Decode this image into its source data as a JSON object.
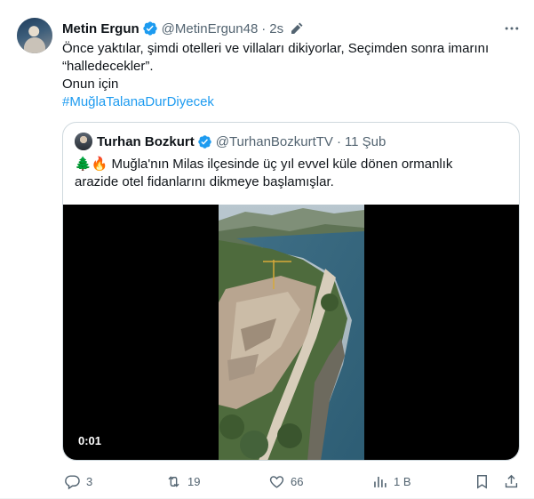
{
  "tweet": {
    "author_name": "Metin Ergun",
    "handle": "@MetinErgun48",
    "separator": "·",
    "time": "2s",
    "lines": [
      "Önce yaktılar, şimdi otelleri ve villaları dikiyorlar, Seçimden sonra imarını",
      "“halledecekler”.",
      "Onun için"
    ],
    "hashtag": "#MuğlaTalanaDurDiyecek"
  },
  "quote": {
    "author_name": "Turhan Bozkurt",
    "handle": "@TurhanBozkurtTV",
    "separator": "·",
    "time": "11 Şub",
    "emoji": "🌲🔥",
    "line1": " Muğla'nın Milas ilçesinde üç yıl evvel küle dönen ormanlık",
    "line2": "arazide otel fidanlarını dikmeye başlamışlar.",
    "video_duration": "0:01"
  },
  "actions": {
    "reply_count": "3",
    "retweet_count": "19",
    "like_count": "66",
    "views_count": "1 B"
  },
  "colors": {
    "accent": "#1d9bf0",
    "secondary_text": "#536471",
    "border": "#cfd9de"
  },
  "icons": [
    "verified-badge-icon",
    "edit-pencil-icon",
    "more-options-icon",
    "reply-icon",
    "retweet-icon",
    "like-icon",
    "views-icon",
    "bookmark-icon",
    "share-icon"
  ]
}
